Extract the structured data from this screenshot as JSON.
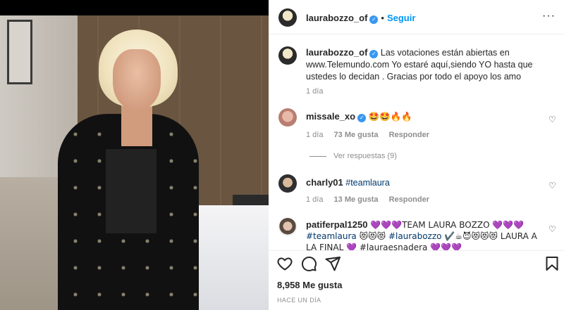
{
  "post": {
    "author": "laurabozzo_of",
    "follow_label": "Seguir",
    "separator": "•",
    "more_label": "···"
  },
  "caption": {
    "username": "laurabozzo_of",
    "text": "Las votaciones están abiertas en www.Telemundo.com Yo estaré aquí,siendo YO hasta que ustedes lo decidan . Gracias por todo el apoyo los amo",
    "age": "1 día"
  },
  "comments": [
    {
      "username": "missale_xo",
      "verified": true,
      "text": "🤩🤩🔥🔥",
      "age": "1 día",
      "likes": "73 Me gusta",
      "reply_label": "Responder",
      "view_replies": "Ver respuestas (9)"
    },
    {
      "username": "charly01",
      "verified": false,
      "text": "#teamlaura",
      "age": "1 día",
      "likes": "13 Me gusta",
      "reply_label": "Responder"
    },
    {
      "username": "patiferpal1250",
      "verified": false,
      "text_line1": "💜💜💜TEAM LAURA BOZZO 💜💜💜",
      "text_line2_tag1": "#teamlaura",
      "text_line2_rest1": " 😻😻😻",
      "text_line2_tag2": "#laurabozzo",
      "text_line2_rest2": " ✔️☕😈😻😻😻 LAURA A",
      "text_line3": "LA FINAL 💜 #lauraesnadera 💜💜💜"
    }
  ],
  "footer": {
    "likes": "8,958 Me gusta",
    "timestamp": "HACE UN DÍA"
  },
  "icons": {
    "like": "heart-icon",
    "comment": "comment-icon",
    "share": "send-icon",
    "save": "bookmark-icon",
    "verified": "verified-badge-icon"
  },
  "colors": {
    "accent": "#0095f6",
    "verified": "#3897f0",
    "muted": "#8e8e8e",
    "text": "#262626"
  }
}
